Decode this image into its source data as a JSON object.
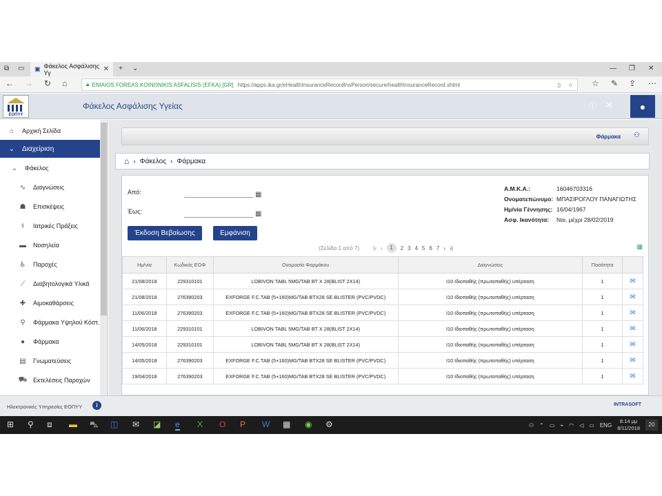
{
  "browser": {
    "tab_title": "Φάκελος Ασφάλισης Υγ",
    "site_identity": "ENIAIOS FOREAS KOINONIKIS ASFALISIS (EFKA) [GR]",
    "url": "https://apps.ika.gr/eHealthInsuranceRecordInsPerson/secure/healthInsuranceRecord.xhtml"
  },
  "app": {
    "logo_text": "ΕΟΠΥΥ",
    "title": "Φάκελος Ασφάλισης Υγείας"
  },
  "sidebar": {
    "items": [
      {
        "label": "Αρχική Σελίδα",
        "icon": "home-icon"
      },
      {
        "label": "Διαχείριση",
        "icon": "chevron-down-icon"
      },
      {
        "label": "Φάκελος",
        "icon": "chevron-down-icon"
      },
      {
        "label": "Διαγνώσεις",
        "icon": "pulse-icon"
      },
      {
        "label": "Επισκέψεις",
        "icon": "doctor-icon"
      },
      {
        "label": "Ιατρικές Πράξεις",
        "icon": "stethoscope-icon"
      },
      {
        "label": "Νοσηλεία",
        "icon": "bed-icon"
      },
      {
        "label": "Παροχές",
        "icon": "wheelchair-icon"
      },
      {
        "label": "Διαβητολογικά Υλικά",
        "icon": "syringe-icon"
      },
      {
        "label": "Αιμοκαθάρσεις",
        "icon": "dialysis-icon"
      },
      {
        "label": "Φάρμακα Υψηλού Κόστ.",
        "icon": "pill-bottle-icon"
      },
      {
        "label": "Φάρμακα",
        "icon": "pills-icon"
      },
      {
        "label": "Γνωματεύσεις",
        "icon": "document-icon"
      },
      {
        "label": "Εκτελέσεις Παροχών",
        "icon": "cart-icon"
      }
    ]
  },
  "main": {
    "panel_title": "Φάρμακα",
    "breadcrumb": [
      "Φάκελος",
      "Φάρμακα"
    ],
    "form": {
      "from_label": "Από:",
      "to_label": "Έως:",
      "issue_button": "Έκδοση Βεβαίωσης",
      "show_button": "Εμφάνιση"
    },
    "patient": {
      "amka_label": "Α.Μ.Κ.Α.:",
      "amka": "16046703316",
      "name_label": "Ονοματεπώνυμο:",
      "name": "ΜΠΑΣΙΡΟΓΛΟΥ ΠΑΝΑΓΙΩΤΗΣ",
      "dob_label": "Ημ/νία Γέννησης:",
      "dob": "16/04/1967",
      "eligibility_label": "Ασφ. Ικανότητα:",
      "eligibility": "Ναι, μέχρι 28/02/2019"
    },
    "pager": {
      "summary": "(Σελίδα 1 από 7)",
      "pages": [
        "1",
        "2",
        "3",
        "4",
        "5",
        "6",
        "7"
      ]
    },
    "table": {
      "headers": [
        "Ημ/νία",
        "Κωδικός ΕΟΦ",
        "Ονομασία Φαρμάκου",
        "Διαγνώσεις",
        "Ποσότητα",
        ""
      ],
      "rows": [
        [
          "21/08/2018",
          "229310101",
          "LOBIVON TABL 5MG/TAB BT X 28(BLIST 2X14)",
          "I10 Ιδιοπαθής (πρωτοπαθής) υπέρταση",
          "1"
        ],
        [
          "21/08/2018",
          "276390203",
          "EXFORGE F.C.TAB (5+160)MG/TAB BTX28 SE BLISTER (PVC/PVDC)",
          "I10 Ιδιοπαθής (πρωτοπαθής) υπέρταση",
          "1"
        ],
        [
          "11/06/2018",
          "276390203",
          "EXFORGE F.C.TAB (5+160)MG/TAB BTX28 SE BLISTER (PVC/PVDC)",
          "I10 Ιδιοπαθής (πρωτοπαθής) υπέρταση",
          "1"
        ],
        [
          "11/06/2018",
          "229310101",
          "LOBIVON TABL 5MG/TAB BT X 28(BLIST 2X14)",
          "I10 Ιδιοπαθής (πρωτοπαθής) υπέρταση",
          "1"
        ],
        [
          "14/05/2018",
          "229310101",
          "LOBIVON TABL 5MG/TAB BT X 28(BLIST 2X14)",
          "I10 Ιδιοπαθής (πρωτοπαθής) υπέρταση",
          "1"
        ],
        [
          "14/05/2018",
          "276390203",
          "EXFORGE F.C.TAB (5+160)MG/TAB BTX28 SE BLISTER (PVC/PVDC)",
          "I10 Ιδιοπαθής (πρωτοπαθής) υπέρταση",
          "1"
        ],
        [
          "19/04/2018",
          "276390203",
          "EXFORGE F.C.TAB (5+160)MG/TAB BTX28 SE BLISTER (PVC/PVDC)",
          "I10 Ιδιοπαθής (πρωτοπαθής) υπέρταση",
          "1"
        ]
      ]
    }
  },
  "footer": {
    "text": "Ηλεκτρονικές Υπηρεσίες ΕΟΠΥΥ",
    "brand": "INTRASOFT"
  },
  "taskbar": {
    "language": "ENG",
    "time": "8:14 μμ",
    "date": "8/11/2018",
    "notifications": "20"
  }
}
